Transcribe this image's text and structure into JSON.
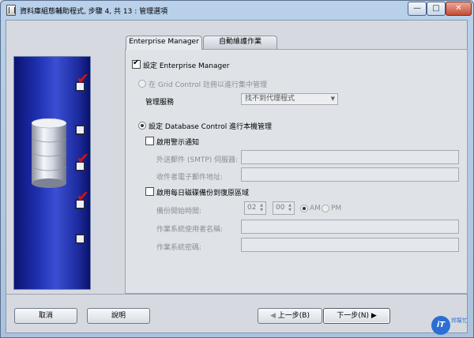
{
  "window": {
    "title": "資料庫組態輔助程式, 步驟 4, 共 13 : 管理選項",
    "min_glyph": "—",
    "max_glyph": "□",
    "close_glyph": "✕"
  },
  "tabs": [
    {
      "label": "Enterprise Manager",
      "active": true
    },
    {
      "label": "自動維護作業",
      "active": false
    }
  ],
  "form": {
    "configure_em": {
      "label": "設定 Enterprise Manager",
      "checked": true
    },
    "grid_control": {
      "label": "在 Grid Control 註冊以進行集中管理",
      "checked": false,
      "enabled": false
    },
    "management_service": {
      "label": "管理服務",
      "value": "找不到代理程式",
      "enabled": false
    },
    "db_control": {
      "label": "設定 Database Control 進行本機管理",
      "checked": true
    },
    "email_notify": {
      "label": "啟用警示通知",
      "checked": false
    },
    "smtp": {
      "label": "外送郵件 (SMTP) 伺服器:",
      "value": ""
    },
    "recipient": {
      "label": "收件者電子郵件地址:",
      "value": ""
    },
    "daily_backup": {
      "label": "啟用每日磁碟備份到復原區域",
      "checked": false
    },
    "backup_time": {
      "label": "備份開始時間:",
      "hour": "02",
      "minute": "00",
      "am_label": "AM",
      "pm_label": "PM",
      "am_selected": true
    },
    "os_username": {
      "label": "作業系統使用者名稱:",
      "value": ""
    },
    "os_password": {
      "label": "作業系統密碼:",
      "value": ""
    }
  },
  "buttons": {
    "cancel": "取消",
    "help": "說明",
    "back": "上一步(B)",
    "next": "下一步(N)"
  },
  "watermark": {
    "logo": "iT",
    "line1": "邦幫忙",
    "line2": ""
  },
  "colors": {
    "panel_blue": "#1e2fb0",
    "check_red": "#d41212"
  }
}
